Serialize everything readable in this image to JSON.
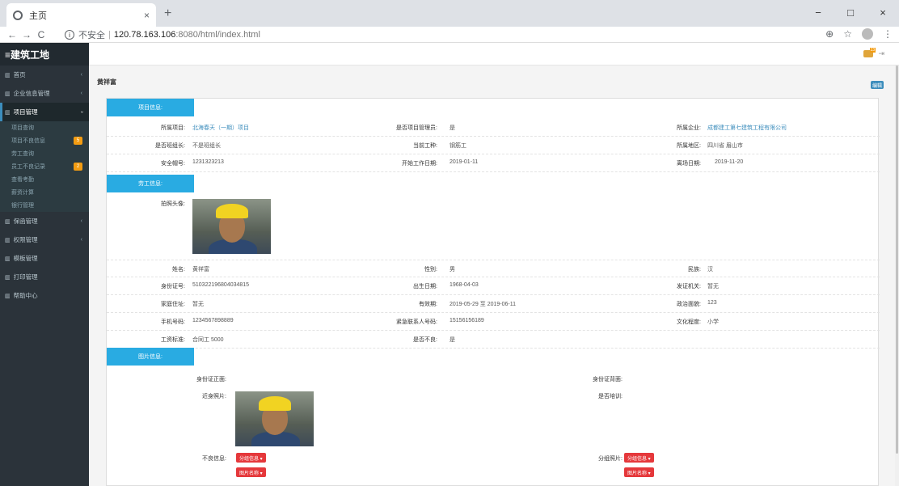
{
  "browser": {
    "tab_title": "主页",
    "tab_close": "×",
    "new_tab": "+",
    "win_min": "−",
    "win_max": "□",
    "win_close": "×",
    "nav_back": "←",
    "nav_forward": "→",
    "nav_reload": "C",
    "info_glyph": "i",
    "insecure": "不安全",
    "url_sep": "|",
    "url_host": "120.78.163.106",
    "url_path": ":8080/html/index.html",
    "zoom_icon": "⊕",
    "star_icon": "☆",
    "menu_icon": "⋮"
  },
  "sidebar": {
    "brand": "≡建筑工地",
    "items": [
      {
        "label": "首页",
        "arrow": "‹"
      },
      {
        "label": "企业信息管理",
        "arrow": "‹"
      },
      {
        "label": "项目管理",
        "arrow": "›"
      },
      {
        "label": "保函管理",
        "arrow": "‹"
      },
      {
        "label": "权限管理",
        "arrow": "‹"
      },
      {
        "label": "模板管理",
        "arrow": ""
      },
      {
        "label": "打印管理",
        "arrow": ""
      },
      {
        "label": "帮助中心",
        "arrow": ""
      }
    ],
    "subitems": [
      {
        "label": "项目查询",
        "badge": ""
      },
      {
        "label": "项目不良信息",
        "badge": "5"
      },
      {
        "label": "劳工查询",
        "badge": ""
      },
      {
        "label": "员工不良记录",
        "badge": "2"
      },
      {
        "label": "查看考勤",
        "badge": ""
      },
      {
        "label": "薪资计算",
        "badge": ""
      },
      {
        "label": "银行管理",
        "badge": ""
      }
    ]
  },
  "topbar": {
    "notif_count": "13",
    "logout_icon": "⇥"
  },
  "page": {
    "title": "黄祥富",
    "edit_label": "编辑"
  },
  "sections": {
    "project": "项目信息:",
    "labor": "劳工信息:",
    "photos": "图片信息:"
  },
  "project_info": {
    "project_label": "所属项目:",
    "project_value": "北海春天（一期）项目",
    "is_manager_label": "是否项目管理员:",
    "is_manager_value": "是",
    "company_label": "所属企业:",
    "company_value": "成都建工第七建筑工程有限公司",
    "is_team_leader_label": "是否班组长:",
    "is_team_leader_value": "不是班组长",
    "work_type_label": "当前工种:",
    "work_type_value": "钢筋工",
    "region_label": "所属地区:",
    "region_value": "四川省 眉山市",
    "helmet_label": "安全帽号:",
    "helmet_value": "1231323213",
    "start_label": "开始工作日期:",
    "start_value": "2019-01-11",
    "leave_label": "离场日期:",
    "leave_value": "2019-11-20"
  },
  "labor_info": {
    "photo_label": "拍照头像:",
    "name_label": "姓名:",
    "name_value": "黄祥富",
    "gender_label": "性别:",
    "gender_value": "男",
    "ethnic_label": "民族:",
    "ethnic_value": "汉",
    "id_label": "身份证号:",
    "id_value": "510322196804034815",
    "birth_label": "出生日期:",
    "birth_value": "1968-04-03",
    "issuer_label": "发证机关:",
    "issuer_value": "暂无",
    "address_label": "家庭住址:",
    "address_value": "暂无",
    "valid_label": "有效期:",
    "valid_value": "2019-05-29 至 2019-06-11",
    "political_label": "政治面貌:",
    "political_value": "123",
    "phone_label": "手机号码:",
    "phone_value": "1234567898889",
    "emergency_label": "紧急联系人号码:",
    "emergency_value": "15156156189",
    "education_label": "文化程度:",
    "education_value": "小学",
    "wage_label": "工资标准:",
    "wage_value": "合同工 5000",
    "bad_label": "是否不良:",
    "bad_value": "是"
  },
  "photo_info": {
    "id_front_label": "身份证正面:",
    "id_back_label": "身份证背面:",
    "closeup_label": "近身照片:",
    "trained_label": "是否培训:",
    "bad_info_label": "不良信息:",
    "group_photo_label": "分组照片:",
    "group_btn": "分组信息 ▾",
    "image_btn": "图片名称 ▾"
  }
}
